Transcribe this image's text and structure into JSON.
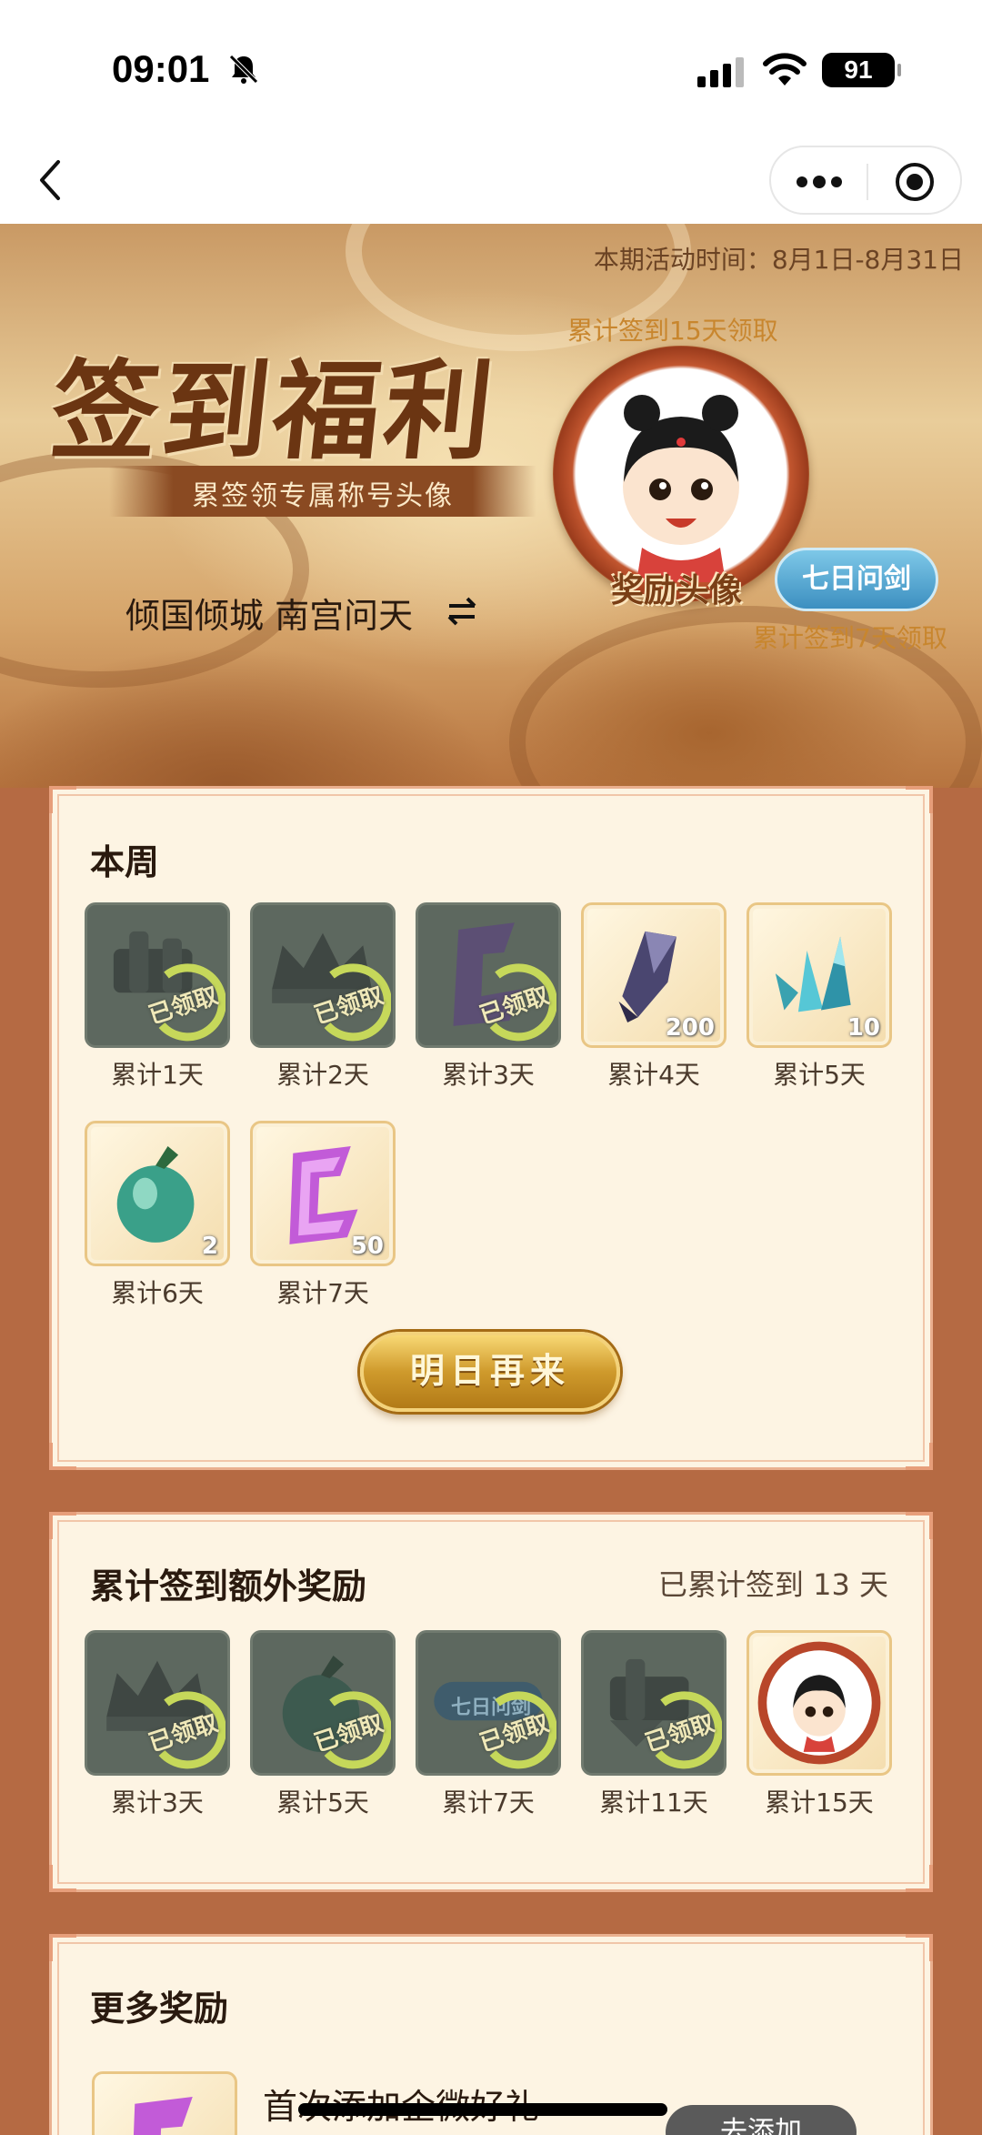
{
  "status": {
    "time": "09:01",
    "battery": "91"
  },
  "hero": {
    "period": "本期活动时间：8月1日-8月31日",
    "title": "签到福利",
    "subtitle": "累签领专属称号头像",
    "username": "倾国倾城 南宫问天",
    "tip15": "累计签到15天领取",
    "avatar_label": "奖励头像",
    "title_badge": "七日问剑",
    "tip7": "累计签到7天领取"
  },
  "week": {
    "title": "本周",
    "stamp": "已领取",
    "items": [
      {
        "day": "累计1天",
        "state": "claimed",
        "icon": "jade-pendant-icon"
      },
      {
        "day": "累计2天",
        "state": "claimed",
        "icon": "crown-icon"
      },
      {
        "day": "累计3天",
        "state": "claimed",
        "icon": "purple-token-icon"
      },
      {
        "day": "累计4天",
        "state": "open",
        "icon": "dark-crystal-icon",
        "qty": "200"
      },
      {
        "day": "累计5天",
        "state": "open",
        "icon": "blue-crystal-icon",
        "qty": "10"
      },
      {
        "day": "累计6天",
        "state": "open",
        "icon": "green-gourd-icon",
        "qty": "2"
      },
      {
        "day": "累计7天",
        "state": "open",
        "icon": "purple-token-icon",
        "qty": "50"
      }
    ],
    "button": "明日再来"
  },
  "cumulative": {
    "title": "累计签到额外奖励",
    "note": "已累计签到 13 天",
    "stamp": "已领取",
    "items": [
      {
        "day": "累计3天",
        "state": "claimed",
        "icon": "crown-icon"
      },
      {
        "day": "累计5天",
        "state": "claimed",
        "icon": "green-gourd-icon"
      },
      {
        "day": "累计7天",
        "state": "claimed",
        "icon": "title-badge-icon",
        "badge": "七日问剑"
      },
      {
        "day": "累计11天",
        "state": "claimed",
        "icon": "jade-pendant-icon"
      },
      {
        "day": "累计15天",
        "state": "open",
        "icon": "avatar-icon"
      }
    ]
  },
  "more": {
    "title": "更多奖励",
    "item_title": "首次添加企微好礼",
    "item_button": "去添加"
  },
  "colors": {
    "accent": "#eab08f",
    "gold": "#cf9a2c",
    "card_bg": "#fdf4e3"
  }
}
